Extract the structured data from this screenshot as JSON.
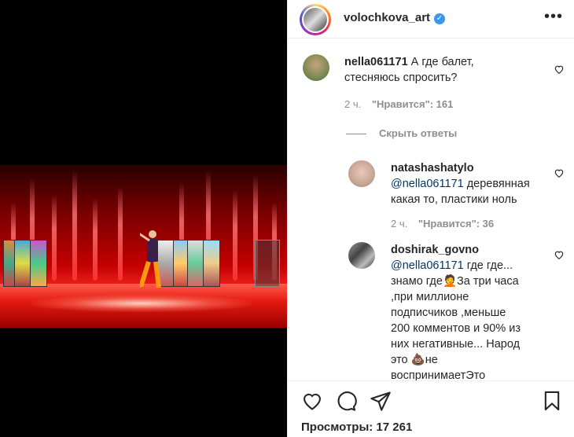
{
  "post": {
    "author": "volochkova_art",
    "verified": true,
    "more_icon": "more-horizontal-icon"
  },
  "comments": [
    {
      "username": "nella061171",
      "text": "А где балет, стесняюсь спросить?",
      "line1": "А где балет,",
      "line2": "стесняюсь спросить?",
      "time": "2 ч.",
      "likes_label": "\"Нравится\": 161",
      "hide_replies": "Скрыть ответы"
    },
    {
      "username": "natashashatylo",
      "mention": "@nella061171",
      "line1": "деревянная",
      "line2": "какая то, пластики ноль",
      "time": "2 ч.",
      "likes_label": "\"Нравится\": 36"
    },
    {
      "username": "doshirak_govno",
      "mention": "@nella061171",
      "line1": "где где...",
      "line2a": "знамо где",
      "line2b": "За три часа",
      "line3": ",при миллионе",
      "line4": "подписчиков ,меньше",
      "line5": "200 комментов и 90% из",
      "line6": "них негативные... Народ",
      "line7a": "это ",
      "line7b": "не",
      "line8": "воспринимаетЭто"
    }
  ],
  "actions": {
    "like_icon": "heart-icon",
    "comment_icon": "comment-icon",
    "share_icon": "send-icon",
    "save_icon": "bookmark-icon"
  },
  "views_label": "Просмотры: 17 261"
}
